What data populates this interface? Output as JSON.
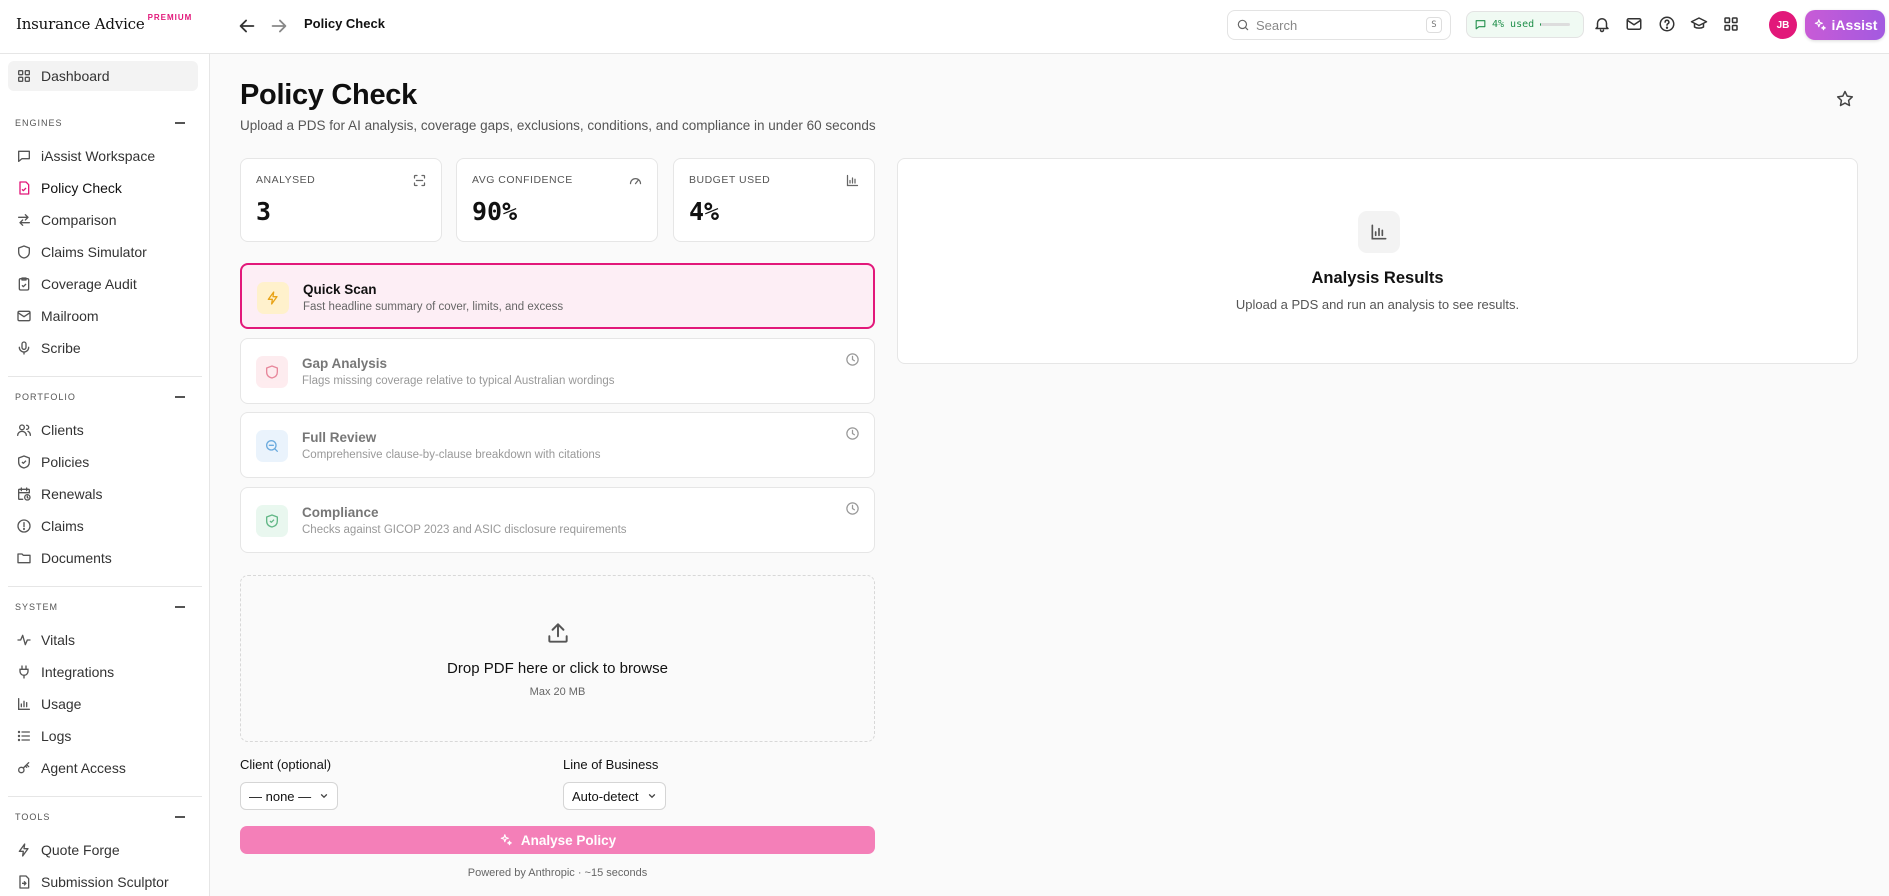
{
  "brand": {
    "name": "Insurance Advice",
    "tier": "PREMIUM"
  },
  "header": {
    "breadcrumb": "Policy Check",
    "search_placeholder": "Search",
    "search_shortcut": "S",
    "usage_text": "4% used",
    "usage_fraction": 0.04,
    "avatar_initials": "JB",
    "iassist_label": "iAssist"
  },
  "sidebar": {
    "home": {
      "label": "Dashboard",
      "icon": "grid-icon"
    },
    "sections": [
      {
        "title": "ENGINES",
        "items": [
          {
            "label": "iAssist Workspace",
            "icon": "chat-icon"
          },
          {
            "label": "Policy Check",
            "icon": "document-check-icon",
            "active": true
          },
          {
            "label": "Comparison",
            "icon": "arrows-swap-icon"
          },
          {
            "label": "Claims Simulator",
            "icon": "shield-icon"
          },
          {
            "label": "Coverage Audit",
            "icon": "clipboard-check-icon"
          },
          {
            "label": "Mailroom",
            "icon": "mail-icon"
          },
          {
            "label": "Scribe",
            "icon": "microphone-icon"
          }
        ]
      },
      {
        "title": "PORTFOLIO",
        "items": [
          {
            "label": "Clients",
            "icon": "users-icon"
          },
          {
            "label": "Policies",
            "icon": "shield-check-icon"
          },
          {
            "label": "Renewals",
            "icon": "calendar-clock-icon"
          },
          {
            "label": "Claims",
            "icon": "alert-circle-icon"
          },
          {
            "label": "Documents",
            "icon": "folder-icon"
          }
        ]
      },
      {
        "title": "SYSTEM",
        "items": [
          {
            "label": "Vitals",
            "icon": "activity-icon"
          },
          {
            "label": "Integrations",
            "icon": "plug-icon"
          },
          {
            "label": "Usage",
            "icon": "bar-chart-icon"
          },
          {
            "label": "Logs",
            "icon": "list-icon"
          },
          {
            "label": "Agent Access",
            "icon": "key-icon"
          }
        ]
      },
      {
        "title": "TOOLS",
        "items": [
          {
            "label": "Quote Forge",
            "icon": "zap-icon"
          },
          {
            "label": "Submission Sculptor",
            "icon": "file-export-icon"
          }
        ]
      }
    ]
  },
  "page": {
    "title": "Policy Check",
    "subtitle": "Upload a PDS for AI analysis, coverage gaps, exclusions, conditions, and compliance in under 60 seconds"
  },
  "stats": [
    {
      "label": "ANALYSED",
      "value": "3",
      "icon": "scan-icon"
    },
    {
      "label": "AVG CONFIDENCE",
      "value": "90%",
      "icon": "gauge-icon"
    },
    {
      "label": "BUDGET USED",
      "value": "4%",
      "icon": "bar-chart-icon"
    }
  ],
  "modes": [
    {
      "title": "Quick Scan",
      "desc": "Fast headline summary of cover, limits, and excess",
      "icon": "zap-icon",
      "color": "#e8a317",
      "bg": "#fff1cc",
      "selected": true
    },
    {
      "title": "Gap Analysis",
      "desc": "Flags missing coverage relative to typical Australian wordings",
      "icon": "shield-icon",
      "color": "#e0607a",
      "bg": "#fde6ea"
    },
    {
      "title": "Full Review",
      "desc": "Comprehensive clause-by-clause breakdown with citations",
      "icon": "search-doc-icon",
      "color": "#3b8fd4",
      "bg": "#e3f0fb"
    },
    {
      "title": "Compliance",
      "desc": "Checks against GICOP 2023 and ASIC disclosure requirements",
      "icon": "shield-check-icon",
      "color": "#2e9f5e",
      "bg": "#e2f5ea"
    }
  ],
  "upload": {
    "title": "Drop PDF here or click to browse",
    "hint": "Max 20 MB"
  },
  "form": {
    "client_label": "Client (optional)",
    "client_value": "— none —",
    "lob_label": "Line of Business",
    "lob_value": "Auto-detect"
  },
  "analyse_button": "Analyse Policy",
  "powered_by": "Powered by Anthropic · ~15 seconds",
  "results": {
    "title": "Analysis Results",
    "subtitle": "Upload a PDS and run an analysis to see results."
  },
  "colors": {
    "accent": "#e2187a",
    "button_disabled": "#f47fb8",
    "usage_green": "#1f8f4a"
  }
}
